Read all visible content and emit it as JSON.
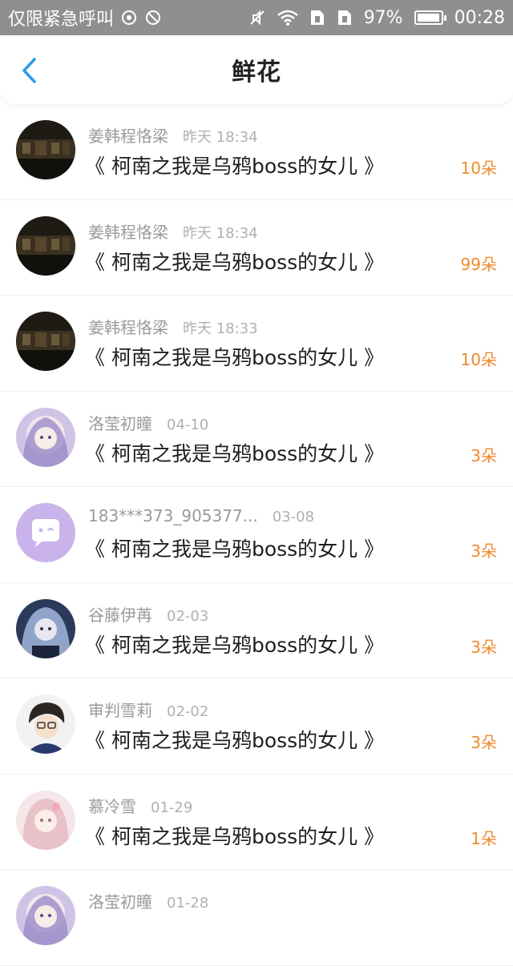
{
  "status_bar": {
    "carrier_text": "仅限紧急呼叫",
    "battery_text": "97%",
    "battery_level": 0.97,
    "time": "00:28"
  },
  "header": {
    "title": "鲜花",
    "back_icon": "chevron-left-icon",
    "accent_color": "#2e9bea"
  },
  "colors": {
    "count": "#f08a2c",
    "name": "#9a9a9a",
    "title": "#1e1e1e"
  },
  "flowers": [
    {
      "name": "姜韩程恪梁",
      "time": "昨天 18:34",
      "book": "《 柯南之我是乌鸦boss的女儿 》",
      "count": "10朵",
      "avatar": "dark-photo"
    },
    {
      "name": "姜韩程恪梁",
      "time": "昨天 18:34",
      "book": "《 柯南之我是乌鸦boss的女儿 》",
      "count": "99朵",
      "avatar": "dark-photo"
    },
    {
      "name": "姜韩程恪梁",
      "time": "昨天 18:33",
      "book": "《 柯南之我是乌鸦boss的女儿 》",
      "count": "10朵",
      "avatar": "dark-photo"
    },
    {
      "name": "洛莹初瞳",
      "time": "04-10",
      "book": "《 柯南之我是乌鸦boss的女儿 》",
      "count": "3朵",
      "avatar": "anime-purple"
    },
    {
      "name": "183***373_905377...",
      "time": "03-08",
      "book": "《 柯南之我是乌鸦boss的女儿 》",
      "count": "3朵",
      "avatar": "default-chat"
    },
    {
      "name": "谷藤伊苒",
      "time": "02-03",
      "book": "《 柯南之我是乌鸦boss的女儿 》",
      "count": "3朵",
      "avatar": "anime-blue"
    },
    {
      "name": "审判雪莉",
      "time": "02-02",
      "book": "《 柯南之我是乌鸦boss的女儿 》",
      "count": "3朵",
      "avatar": "anime-conan"
    },
    {
      "name": "慕冷雪",
      "time": "01-29",
      "book": "《 柯南之我是乌鸦boss的女儿 》",
      "count": "1朵",
      "avatar": "anime-pink"
    },
    {
      "name": "洛莹初瞳",
      "time": "01-28",
      "book": "",
      "count": "",
      "avatar": "anime-purple"
    }
  ]
}
